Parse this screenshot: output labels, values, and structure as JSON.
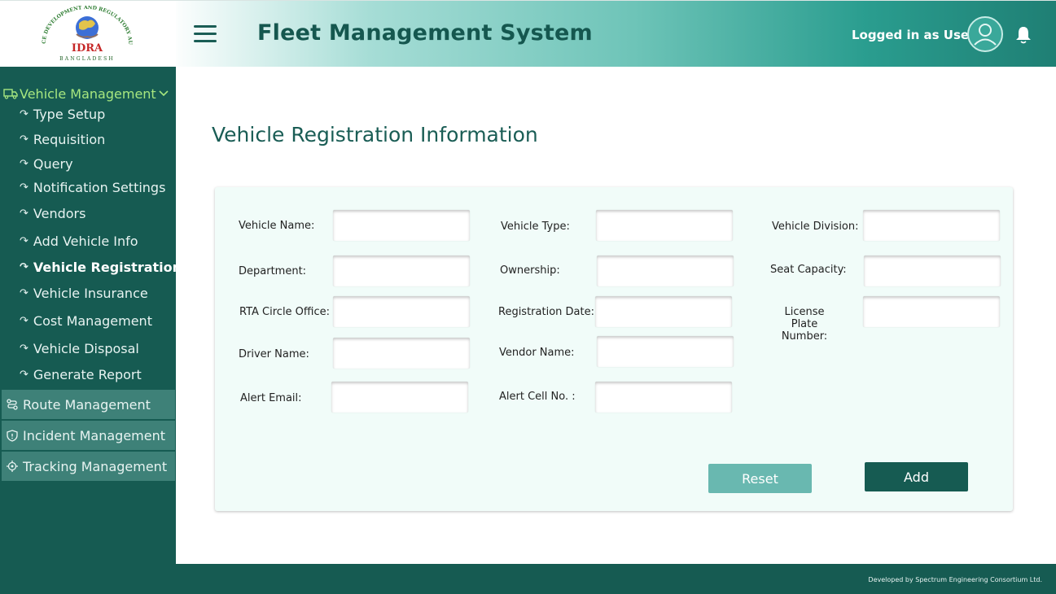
{
  "header": {
    "logo_text": "IDRA",
    "logo_ring_text": "INSURANCE DEVELOPMENT AND REGULATORY AUTHORITY",
    "logo_country": "BANGLADESH",
    "app_title": "Fleet Management System",
    "logged_in_text": "Logged in as User"
  },
  "sidebar": {
    "group_label": "Vehicle Management",
    "sub_items": [
      "Type Setup",
      "Requisition",
      "Query",
      "Notification Settings",
      "Vendors",
      "Add Vehicle Info",
      "Vehicle Registration",
      "Vehicle Insurance",
      "Cost Management",
      "Vehicle Disposal",
      "Generate Report"
    ],
    "active_item": "Vehicle Registration",
    "sections": [
      "Route Management",
      "Incident Management",
      "Tracking Management"
    ]
  },
  "page": {
    "title": "Vehicle Registration Information"
  },
  "form": {
    "fields": {
      "vehicle_name": {
        "label": "Vehicle Name:",
        "value": ""
      },
      "vehicle_type": {
        "label": "Vehicle Type:",
        "value": ""
      },
      "vehicle_division": {
        "label": "Vehicle Division:",
        "value": ""
      },
      "department": {
        "label": "Department:",
        "value": ""
      },
      "ownership": {
        "label": "Ownership:",
        "value": ""
      },
      "seat_capacity": {
        "label": "Seat Capacity:",
        "value": ""
      },
      "rta_circle_office": {
        "label": "RTA Circle Office:",
        "value": ""
      },
      "registration_date": {
        "label": "Registration Date:",
        "value": ""
      },
      "license_plate_number": {
        "label_line1": "License Plate",
        "label_line2": "Number:",
        "value": ""
      },
      "driver_name": {
        "label": "Driver Name:",
        "value": ""
      },
      "vendor_name": {
        "label": "Vendor Name:",
        "value": ""
      },
      "alert_email": {
        "label": "Alert Email:",
        "value": ""
      },
      "alert_cell_no": {
        "label": "Alert Cell No. :",
        "value": ""
      }
    },
    "reset_label": "Reset",
    "add_label": "Add"
  },
  "footer": {
    "credit": "Developed by Spectrum Engineering Consortium Ltd."
  },
  "colors": {
    "primary": "#165b52",
    "accent_green": "#a6e67f",
    "reset_button": "#69b8b0",
    "card_bg": "#f1fcf9"
  },
  "icons": {
    "menu": "hamburger-icon",
    "avatar": "user-avatar-icon",
    "notifications": "bell-icon",
    "vehicle": "truck-icon",
    "expand": "chevron-down-icon",
    "sub_item": "curved-arrow-icon",
    "route": "route-icon",
    "incident": "shield-icon",
    "tracking": "crosshair-icon"
  }
}
